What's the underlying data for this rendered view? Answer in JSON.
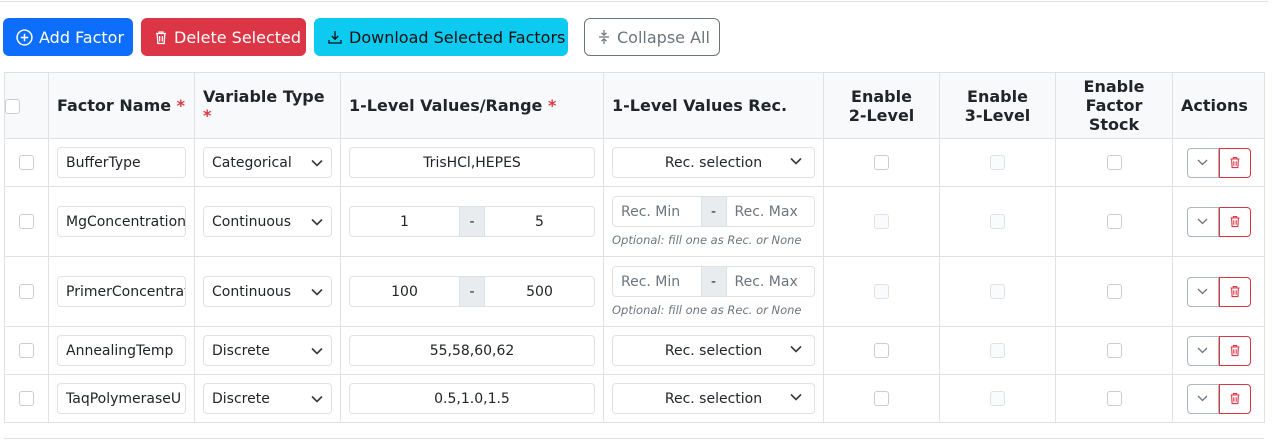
{
  "toolbar": {
    "add_label": "Add Factor",
    "delete_label": "Delete Selected",
    "download_label": "Download Selected Factors",
    "collapse_label": "Collapse All"
  },
  "columns": {
    "factor_name": "Factor Name",
    "variable_type": "Variable Type",
    "level_values": "1-Level Values/Range",
    "level_rec": "1-Level Values Rec.",
    "enable_2_line1": "Enable",
    "enable_2_line2": "2-Level",
    "enable_3_line1": "Enable",
    "enable_3_line2": "3-Level",
    "enable_stock_line1": "Enable",
    "enable_stock_line2": "Factor Stock",
    "actions": "Actions",
    "required_mark": "*"
  },
  "rows": [
    {
      "name": "BufferType",
      "type": "Categorical",
      "values": "TrisHCl,HEPES",
      "rec": "Rec. selection"
    },
    {
      "name": "MgConcentration",
      "type": "Continuous",
      "min": "1",
      "max": "5",
      "rec_min": "Rec. Min",
      "rec_max": "Rec. Max",
      "hint": "Optional: fill one as Rec. or None"
    },
    {
      "name": "PrimerConcentration",
      "type": "Continuous",
      "min": "100",
      "max": "500",
      "rec_min": "Rec. Min",
      "rec_max": "Rec. Max",
      "hint": "Optional: fill one as Rec. or None"
    },
    {
      "name": "AnnealingTemp",
      "type": "Discrete",
      "values": "55,58,60,62",
      "rec": "Rec. selection"
    },
    {
      "name": "TaqPolymeraseU",
      "type": "Discrete",
      "values": "0.5,1.0,1.5",
      "rec": "Rec. selection"
    }
  ],
  "range_separator": "-",
  "colors": {
    "primary": "#0d6efd",
    "danger": "#dc3545",
    "info": "#0dcaf0",
    "secondary": "#6c757d"
  }
}
